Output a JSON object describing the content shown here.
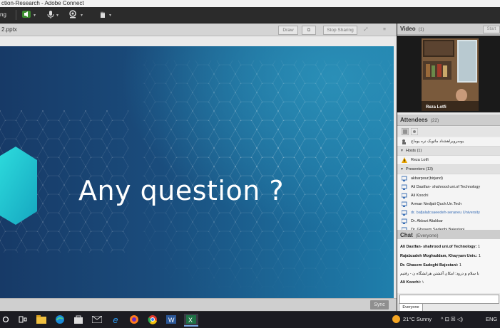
{
  "window": {
    "title": "ction-Research - Adobe Connect"
  },
  "toolbar": {
    "meeting_menu": "ng"
  },
  "share_pod": {
    "filename": "2.pptx",
    "draw_label": "Draw",
    "stop_sharing_label": "Stop Sharing",
    "slide_title": "Any question ?",
    "sync_label": "Sync"
  },
  "video_pod": {
    "title": "Video",
    "count": "(1)",
    "start_label": "Start",
    "presenter_name": "Reza Lotfi"
  },
  "attendees_pod": {
    "title": "Attendees",
    "count": "(22)",
    "meeting_owner": "یوسرویراهشناد ماتویک نره یوماج",
    "hosts_header": "Hosts (1)",
    "hosts": [
      "Reza Lotfi"
    ],
    "presenters_header": "Presenters (13)",
    "presenters": [
      "akbarpour(birjand)",
      "Ali Dastfan- shahrood uni.of Technology",
      "Ali Koochi",
      "Arman Nedjati Quch.Un.Tech",
      "dr. bafjalab:saeedeh-seraneu University",
      "Dr. Akbari Aliakbar",
      "Dr. Ghasem Sadeghi Bajestani"
    ]
  },
  "chat_pod": {
    "title": "Chat",
    "scope": "(Everyone)",
    "messages": [
      {
        "author": "Ali Dastfan- shahrood uni.of Technology:",
        "text": " 1"
      },
      {
        "author": "Rajabzadeh Moghaddam, Khayyam Univ.:",
        "text": " 1"
      },
      {
        "author": "Dr. Ghasem Sadeghi Bajestani:",
        "text": " 1"
      },
      {
        "author": "",
        "text": "با سلام و درود: امکان آغشتن هرانشگاه ن - رفتیم"
      },
      {
        "author": "Ali Koochi:",
        "text": " ۱"
      }
    ],
    "tab_label": "Everyone"
  },
  "taskbar": {
    "weather": "21°C Sunny",
    "tray_icons_text": "^ ⊡ ☒ ◁)",
    "lang": "ENG"
  },
  "colors": {
    "slide_left": "#173a67",
    "slide_right": "#1f7fac",
    "hexagon": "#1ec9d4",
    "link_blue": "#3b6fb5"
  }
}
